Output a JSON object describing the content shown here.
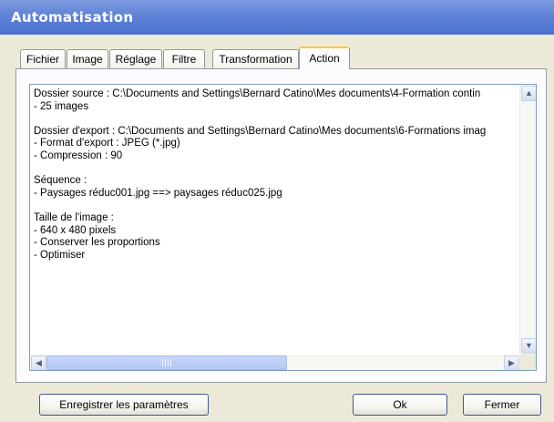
{
  "window": {
    "title": "Automatisation"
  },
  "tabs": [
    {
      "label": "Fichier"
    },
    {
      "label": "Image"
    },
    {
      "label": "Réglage"
    },
    {
      "label": "Filtre"
    },
    {
      "label": "Transformation"
    },
    {
      "label": "Action",
      "active": true
    }
  ],
  "summary": {
    "lines": [
      "Dossier source : C:\\Documents and Settings\\Bernard Catino\\Mes documents\\4-Formation contin",
      "- 25 images",
      "",
      "Dossier d'export : C:\\Documents and Settings\\Bernard Catino\\Mes documents\\6-Formations imag",
      "- Format d'export : JPEG (*.jpg)",
      "- Compression : 90",
      "",
      "Séquence :",
      "- Paysages réduc001.jpg ==> paysages réduc025.jpg",
      "",
      "Taille de l'image :",
      "- 640 x 480 pixels",
      "- Conserver les proportions",
      "- Optimiser"
    ]
  },
  "buttons": {
    "save_params": "Enregistrer les paramètres",
    "ok": "Ok",
    "close": "Fermer"
  },
  "icons": {
    "scroll_up": "scroll-up-arrow-icon",
    "scroll_down": "scroll-down-arrow-icon",
    "scroll_left": "scroll-left-arrow-icon",
    "scroll_right": "scroll-right-arrow-icon"
  },
  "colors": {
    "titlebar": "#5f82d6",
    "dialog_bg": "#ece9d8",
    "active_tab_accent": "#ffc83c",
    "button_border": "#3c5a92"
  }
}
